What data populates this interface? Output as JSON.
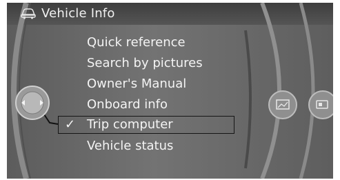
{
  "header": {
    "title": "Vehicle Info",
    "icon": "car-icon"
  },
  "menu": {
    "items": [
      {
        "label": "Quick reference"
      },
      {
        "label": "Search by pictures"
      },
      {
        "label": "Owner's Manual"
      },
      {
        "label": "Onboard info"
      },
      {
        "label": "Trip computer",
        "selected": true,
        "check": "✓"
      },
      {
        "label": "Vehicle status"
      }
    ]
  },
  "colors": {
    "background": "#6b6b6b",
    "header_background": "#4a4a4a",
    "text": "#f4f4f4",
    "selection_border": "#151515"
  },
  "icons": {
    "controller": "controller-dial-icon",
    "right_button_1": "photo-icon",
    "right_button_2": "card-icon"
  }
}
